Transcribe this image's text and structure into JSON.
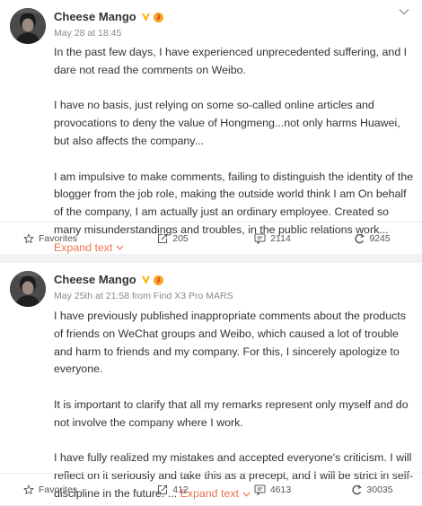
{
  "posts": [
    {
      "author": "Cheese Mango",
      "meta": "May 28 at 18:45",
      "paragraphs": [
        "In the past few days, I have experienced unprecedented suffering, and I dare not read the comments on Weibo.",
        "I have no basis, just relying on some so-called online articles and provocations to deny the value of Hongmeng...not only harms Huawei, but also affects the company...",
        "I am impulsive to make comments, failing to distinguish the identity of the blogger from the job role, making the outside world think I am On behalf of the company, I am actually just an ordinary employee. Created so many misunderstandings and troubles, in the public relations work..."
      ],
      "expand_label": "Expand text",
      "actions": {
        "favorites": "Favorites",
        "reposts": "205",
        "comments": "2114",
        "likes": "9245"
      }
    },
    {
      "author": "Cheese Mango",
      "meta": "May 25th at 21:58 from Find X3 Pro MARS",
      "paragraphs": [
        "I have previously published inappropriate comments about the products of friends on WeChat groups and Weibo, which caused a lot of trouble and harm to friends and my company. For this, I sincerely apologize to everyone.",
        "It is important to clarify that all my remarks represent only myself and do not involve the company where I work.",
        "I have fully realized my mistakes and accepted everyone's criticism. I will reflect on it seriously and take this as a precept, and I will be strict in self-discipline in the future. ..."
      ],
      "expand_label": "Expand text",
      "actions": {
        "favorites": "Favorites",
        "reposts": "412",
        "comments": "4613",
        "likes": "30035"
      }
    }
  ],
  "colors": {
    "accent": "#eb7350",
    "verified": "#f7b500",
    "background": "#f2f2f2"
  },
  "icons": [
    "star-icon",
    "repost-icon",
    "comment-icon",
    "like-icon",
    "chevron-down-icon",
    "verified-badge-icon",
    "fire-badge-icon"
  ]
}
